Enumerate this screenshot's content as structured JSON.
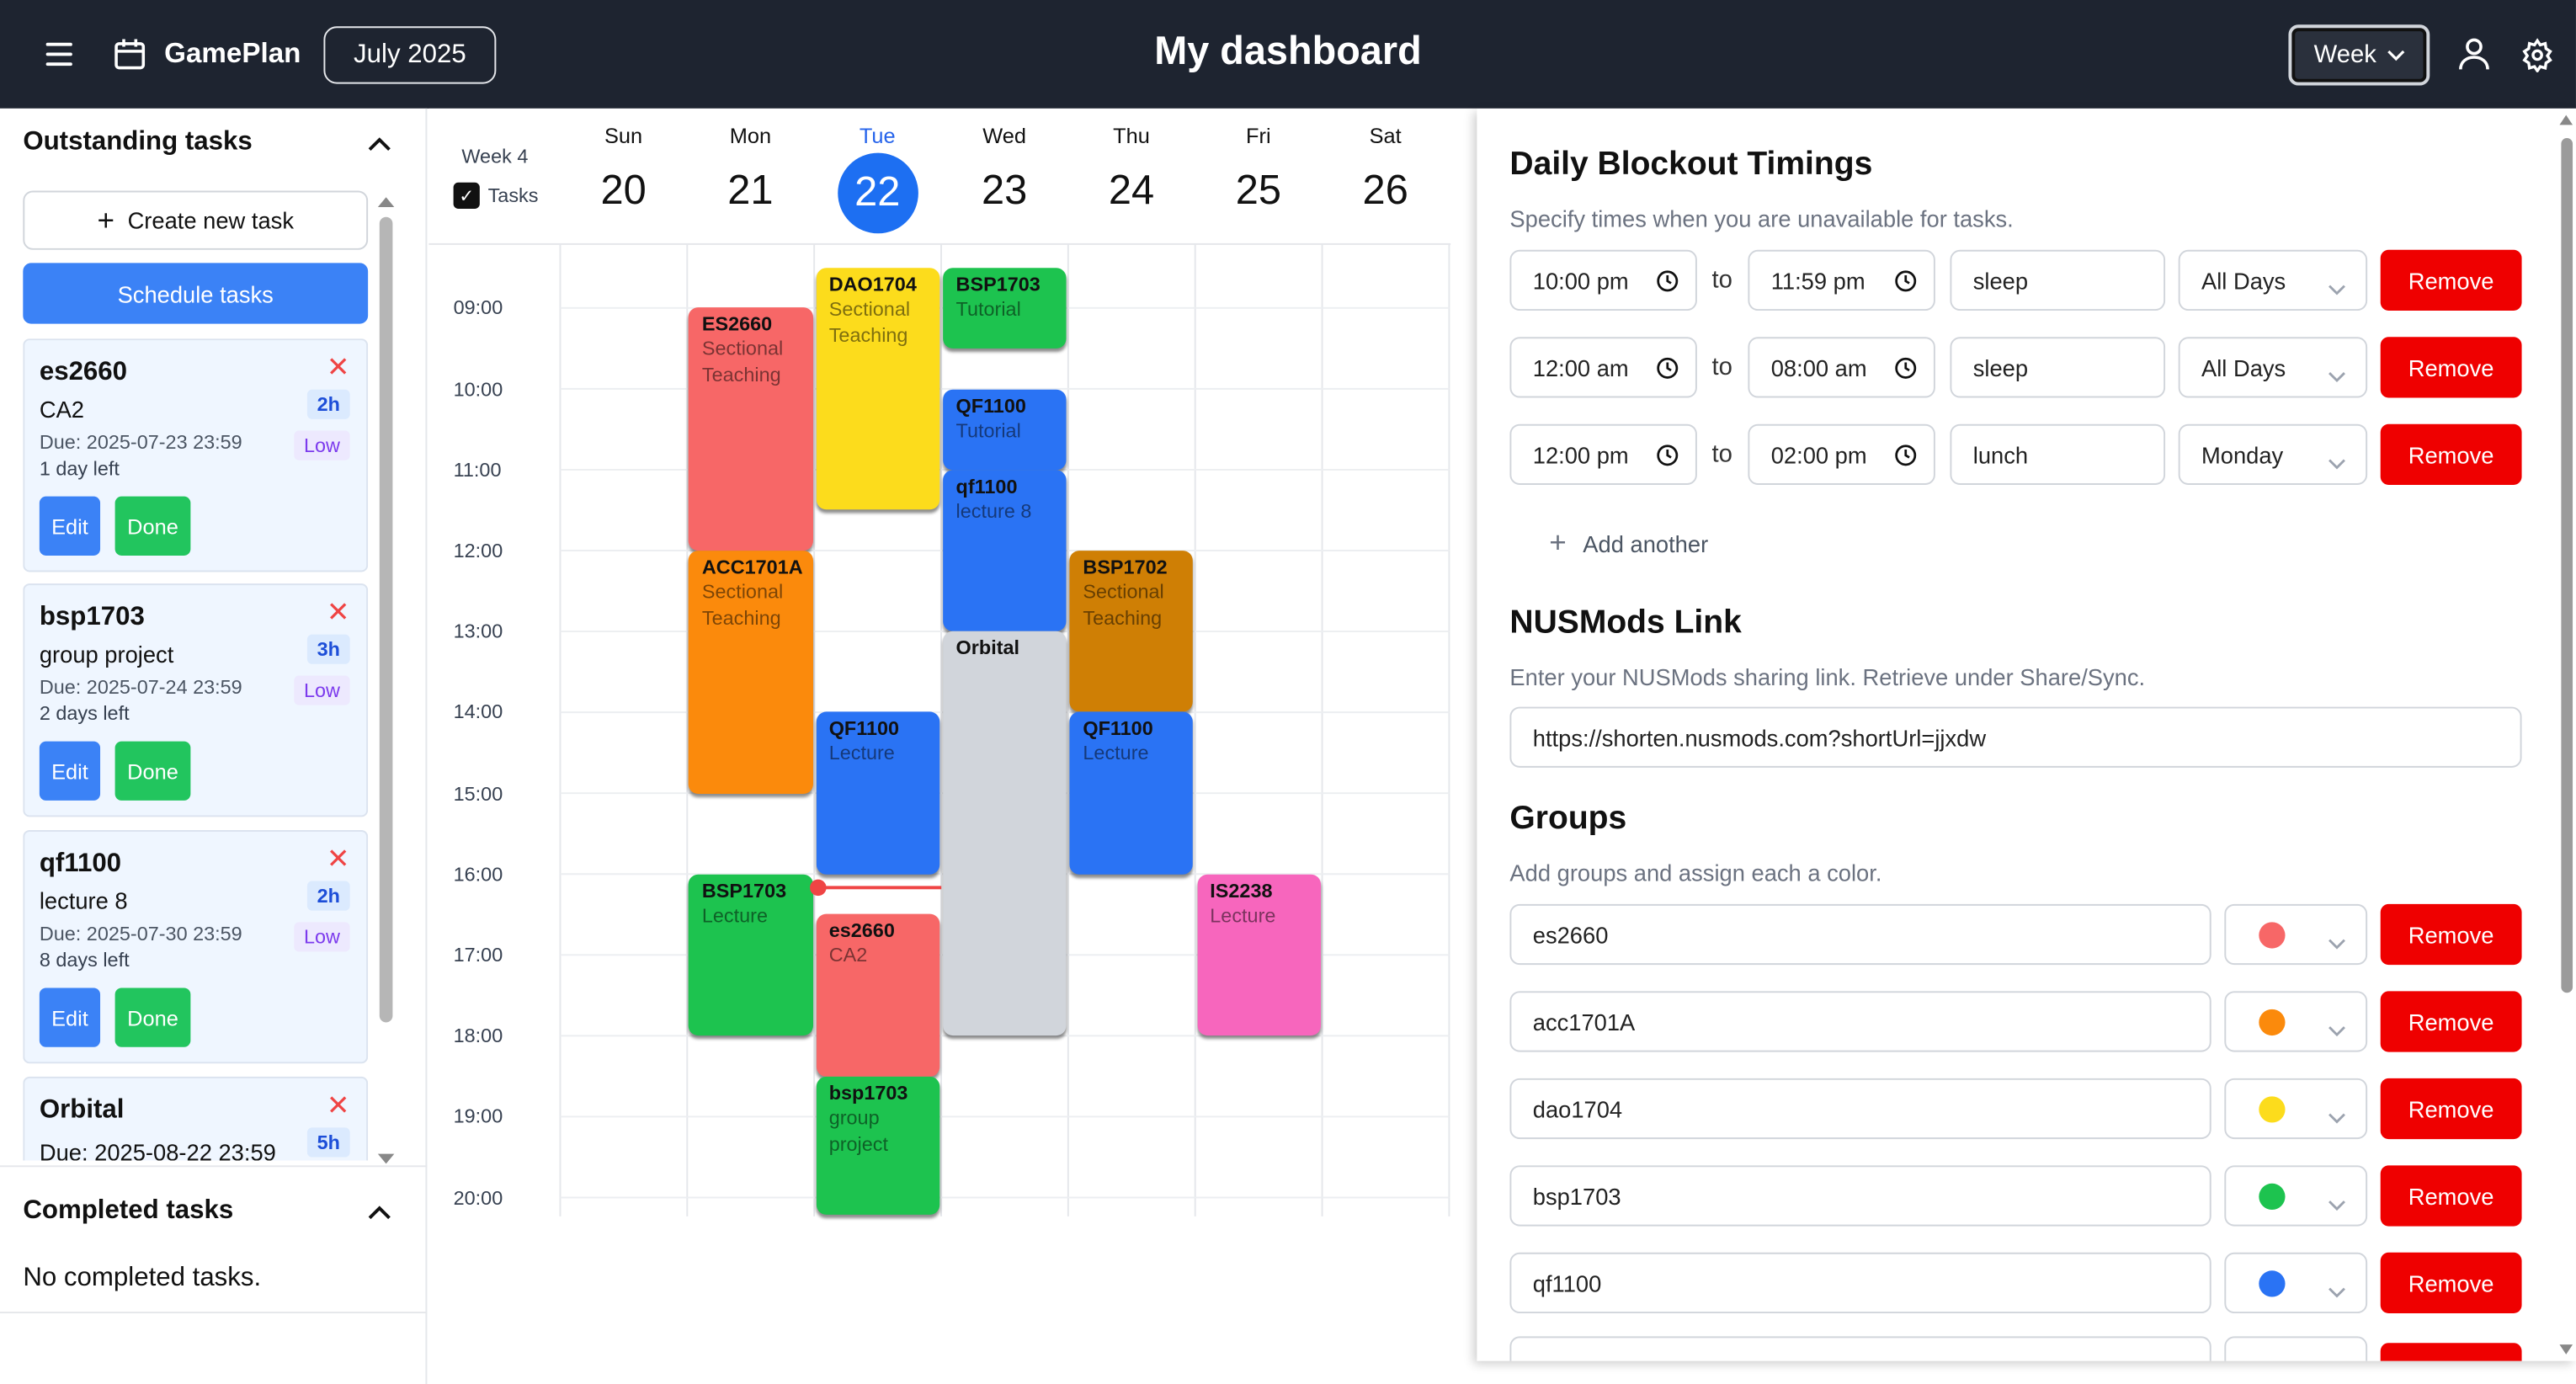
{
  "header": {
    "app_name": "GamePlan",
    "month": "July 2025",
    "title": "My dashboard",
    "view": "Week"
  },
  "left": {
    "outstanding_title": "Outstanding tasks",
    "create_label": "Create new task",
    "schedule_label": "Schedule tasks",
    "tasks": [
      {
        "code": "es2660",
        "name": "CA2",
        "due": "Due: 2025-07-23 23:59",
        "left": "1 day left",
        "hours": "2h",
        "priority": "Low",
        "edit": "Edit",
        "done": "Done"
      },
      {
        "code": "bsp1703",
        "name": "group project",
        "due": "Due: 2025-07-24 23:59",
        "left": "2 days left",
        "hours": "3h",
        "priority": "Low",
        "edit": "Edit",
        "done": "Done"
      },
      {
        "code": "qf1100",
        "name": "lecture 8",
        "due": "Due: 2025-07-30 23:59",
        "left": "8 days left",
        "hours": "2h",
        "priority": "Low",
        "edit": "Edit",
        "done": "Done"
      },
      {
        "code": "Orbital",
        "name": "",
        "due": "Due: 2025-08-22 23:59",
        "left": "",
        "hours": "5h",
        "priority": "",
        "edit": "",
        "done": ""
      }
    ],
    "completed_title": "Completed tasks",
    "completed_empty": "No completed tasks."
  },
  "calendar": {
    "week_label": "Week 4",
    "tasks_toggle": "Tasks",
    "days": [
      {
        "name": "Sun",
        "date": "20"
      },
      {
        "name": "Mon",
        "date": "21"
      },
      {
        "name": "Tue",
        "date": "22"
      },
      {
        "name": "Wed",
        "date": "23"
      },
      {
        "name": "Thu",
        "date": "24"
      },
      {
        "name": "Fri",
        "date": "25"
      },
      {
        "name": "Sat",
        "date": "26"
      }
    ],
    "times": [
      "09:00",
      "10:00",
      "11:00",
      "12:00",
      "13:00",
      "14:00",
      "15:00",
      "16:00",
      "17:00",
      "18:00",
      "19:00",
      "20:00"
    ],
    "events": [
      {
        "day": 1,
        "start": 9.0,
        "end": 12.0,
        "title": "ES2660",
        "sub": "Sectional Teaching",
        "color": "#f76767"
      },
      {
        "day": 1,
        "start": 12.0,
        "end": 15.0,
        "title": "ACC1701A",
        "sub": "Sectional Teaching",
        "color": "#fb8a0c"
      },
      {
        "day": 1,
        "start": 16.0,
        "end": 18.0,
        "title": "BSP1703",
        "sub": "Lecture",
        "color": "#1dc34f"
      },
      {
        "day": 2,
        "start": 8.5,
        "end": 11.5,
        "title": "DAO1704",
        "sub": "Sectional Teaching",
        "color": "#fcdc1c"
      },
      {
        "day": 2,
        "start": 14.0,
        "end": 16.0,
        "title": "QF1100",
        "sub": "Lecture",
        "color": "#2a73f4"
      },
      {
        "day": 2,
        "start": 16.5,
        "end": 18.5,
        "title": "es2660",
        "sub": "CA2",
        "color": "#f76767"
      },
      {
        "day": 2,
        "start": 18.5,
        "end": 20.3,
        "title": "bsp1703",
        "sub": "group project",
        "color": "#1dc34f"
      },
      {
        "day": 3,
        "start": 8.5,
        "end": 9.5,
        "title": "BSP1703",
        "sub": "Tutorial",
        "color": "#1dc34f"
      },
      {
        "day": 3,
        "start": 10.0,
        "end": 11.0,
        "title": "QF1100",
        "sub": "Tutorial",
        "color": "#2a73f4"
      },
      {
        "day": 3,
        "start": 11.0,
        "end": 13.0,
        "title": "qf1100",
        "sub": "lecture 8",
        "color": "#2a73f4"
      },
      {
        "day": 3,
        "start": 13.0,
        "end": 18.0,
        "title": "Orbital",
        "sub": "",
        "color": "#d1d5db"
      },
      {
        "day": 4,
        "start": 12.0,
        "end": 14.0,
        "title": "BSP1702",
        "sub": "Sectional Teaching",
        "color": "#cf7f05"
      },
      {
        "day": 4,
        "start": 14.0,
        "end": 16.0,
        "title": "QF1100",
        "sub": "Lecture",
        "color": "#2a73f4"
      },
      {
        "day": 5,
        "start": 16.0,
        "end": 18.0,
        "title": "IS2238",
        "sub": "Lecture",
        "color": "#f766bd"
      }
    ],
    "now_hour": 16.15
  },
  "settings": {
    "blockout_title": "Daily Blockout Timings",
    "blockout_desc": "Specify times when you are unavailable for tasks.",
    "to_label": "to",
    "blockouts": [
      {
        "start": "10:00 pm",
        "end": "11:59 pm",
        "label": "sleep",
        "days": "All Days",
        "remove": "Remove"
      },
      {
        "start": "12:00 am",
        "end": "08:00 am",
        "label": "sleep",
        "days": "All Days",
        "remove": "Remove"
      },
      {
        "start": "12:00 pm",
        "end": "02:00 pm",
        "label": "lunch",
        "days": "Monday",
        "remove": "Remove"
      }
    ],
    "add_another": "Add another",
    "nusmods_title": "NUSMods Link",
    "nusmods_desc": "Enter your NUSMods sharing link. Retrieve under Share/Sync.",
    "nusmods_url": "https://shorten.nusmods.com?shortUrl=jjxdw",
    "groups_title": "Groups",
    "groups_desc": "Add groups and assign each a color.",
    "groups": [
      {
        "name": "es2660",
        "color": "#f76767",
        "remove": "Remove"
      },
      {
        "name": "acc1701A",
        "color": "#fb8a0c",
        "remove": "Remove"
      },
      {
        "name": "dao1704",
        "color": "#fcdc1c",
        "remove": "Remove"
      },
      {
        "name": "bsp1703",
        "color": "#1dc34f",
        "remove": "Remove"
      },
      {
        "name": "qf1100",
        "color": "#2a73f4",
        "remove": "Remove"
      }
    ]
  }
}
